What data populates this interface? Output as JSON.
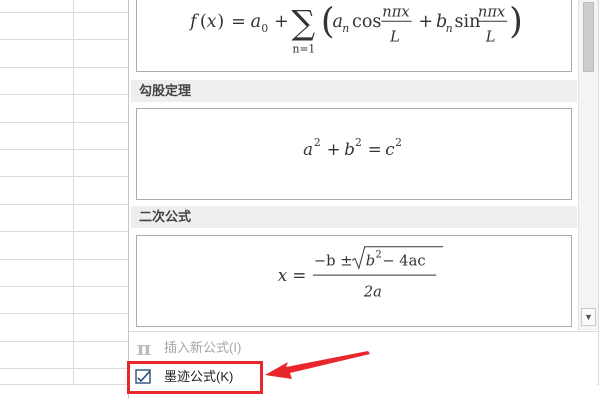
{
  "gallery": {
    "sections": [
      {
        "header": "",
        "formula": "fourier-series"
      },
      {
        "header": "勾股定理",
        "formula": "pythagorean"
      },
      {
        "header": "二次公式",
        "formula": "quadratic"
      }
    ],
    "fourier": {
      "f": "f",
      "x": "x",
      "eq": "=",
      "a0": "a",
      "zero": "0",
      "plus": "+",
      "sum": "∑",
      "sub": "n=1",
      "an": "a",
      "n": "n",
      "cos": "cos",
      "sin": "sin",
      "bn": "b",
      "npix": "nπx",
      "L": "L",
      "lparen": "(",
      "rparen": ")"
    },
    "pythagorean": {
      "a": "a",
      "b": "b",
      "c": "c",
      "two": "2",
      "plus": "+",
      "eq": "="
    },
    "quadratic": {
      "x": "x",
      "eq": "=",
      "num": "−b ± ",
      "rad": "b",
      "two": "2",
      "minus": " − 4ac",
      "den": "2a"
    }
  },
  "menu": {
    "insert_new": "插入新公式(I)",
    "ink_equation": "墨迹公式(K)"
  },
  "icons": {
    "insert": "pi-icon",
    "ink": "ink-equation-icon"
  },
  "colors": {
    "highlight": "#e8262b",
    "arrow": "#e8262b"
  }
}
